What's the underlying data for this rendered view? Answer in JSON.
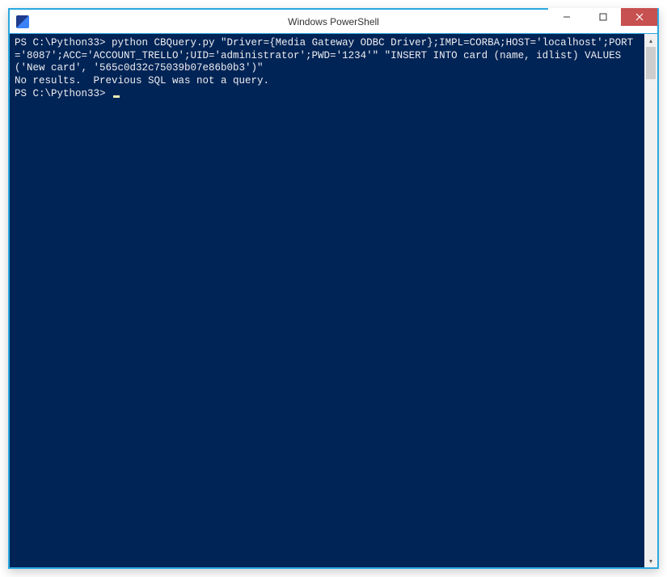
{
  "window": {
    "title": "Windows PowerShell"
  },
  "terminal": {
    "prompt1": "PS C:\\Python33>",
    "command": " python CBQuery.py \"Driver={Media Gateway ODBC Driver};IMPL=CORBA;HOST='localhost';PORT='8087';ACC='ACCOUNT_TRELLO';UID='administrator';PWD='1234'\" \"INSERT INTO card (name, idlist) VALUES ('New card', '565c0d32c75039b07e86b0b3')\"",
    "output_line1": "No results.  Previous SQL was not a query.",
    "prompt2": "PS C:\\Python33>"
  }
}
